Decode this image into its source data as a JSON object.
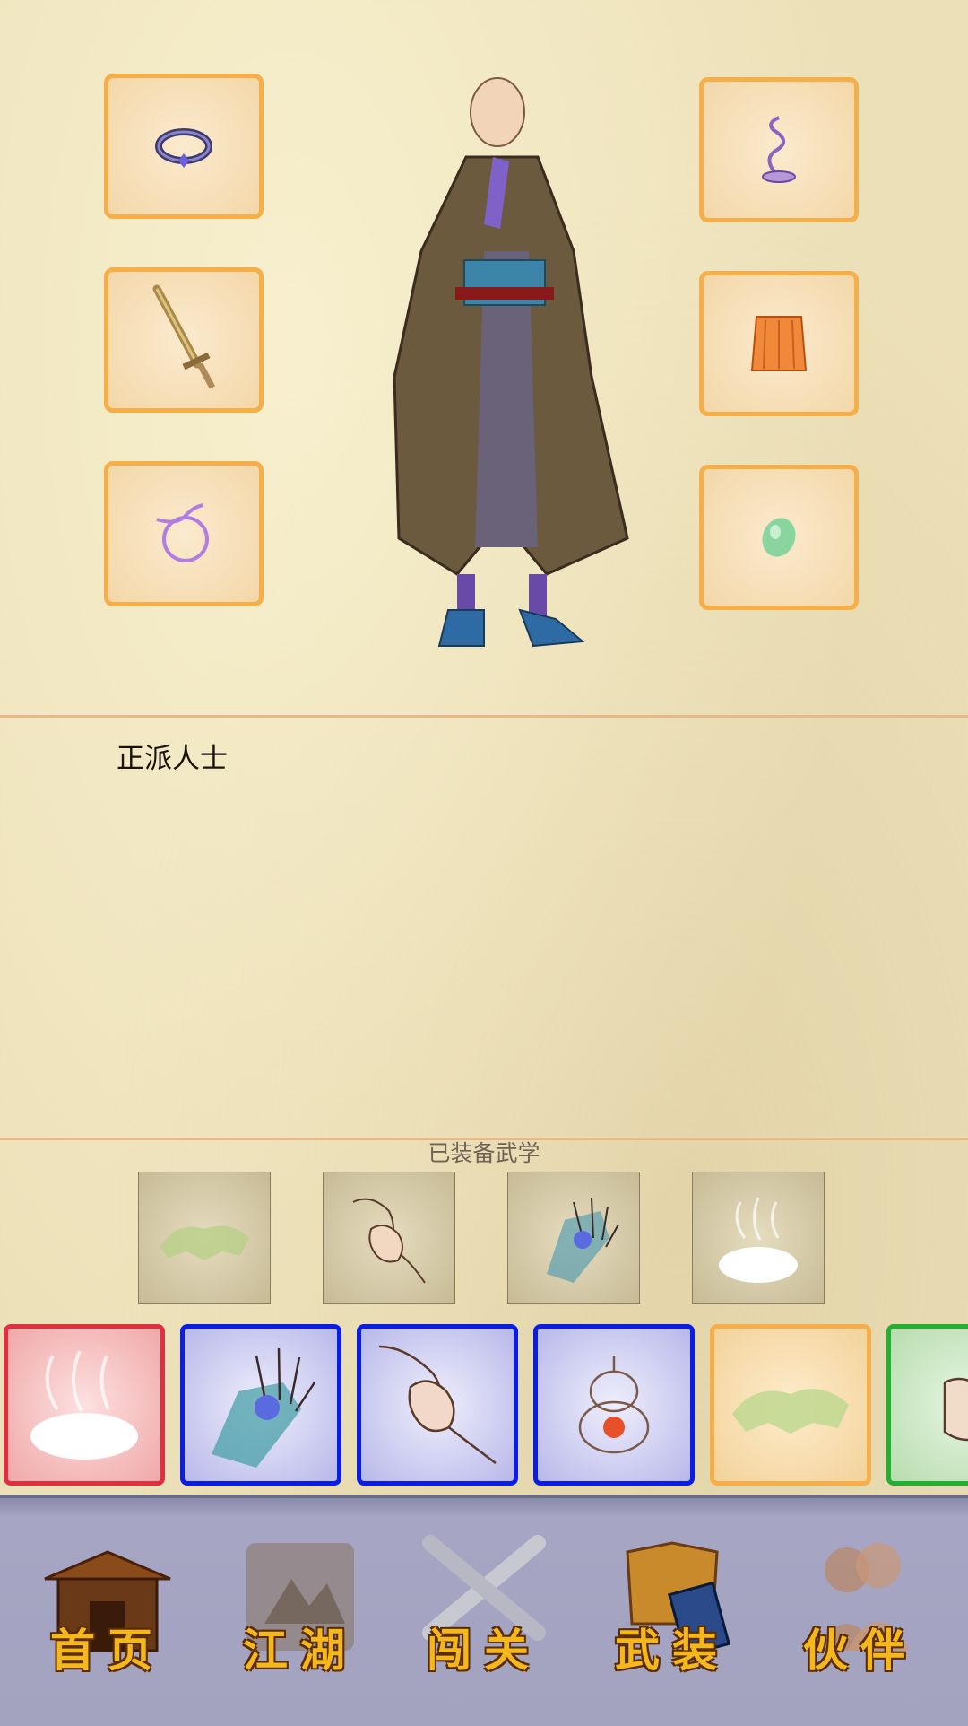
{
  "character": {
    "title": "正派人士",
    "hero_image": "monk-hero",
    "equipment_left": [
      {
        "name": "ring",
        "icon": "purple-ring-icon"
      },
      {
        "name": "sword",
        "icon": "sword-icon"
      },
      {
        "name": "bracelet",
        "icon": "ribbon-ring-icon"
      }
    ],
    "equipment_right": [
      {
        "name": "incense",
        "icon": "incense-icon"
      },
      {
        "name": "robe",
        "icon": "orange-cloth-icon"
      },
      {
        "name": "jade",
        "icon": "jade-icon"
      }
    ]
  },
  "martial": {
    "header": "已装备武学",
    "equipped": [
      "green-beast-icon",
      "clasped-fists-icon",
      "palm-strike-icon",
      "mist-cloud-icon"
    ]
  },
  "skills_strip": [
    {
      "icon": "mist-cloud-icon",
      "color": "red"
    },
    {
      "icon": "palm-strike-icon",
      "color": "blue"
    },
    {
      "icon": "clasped-fists-icon",
      "color": "blue"
    },
    {
      "icon": "gourd-icon",
      "color": "blue"
    },
    {
      "icon": "green-beast-icon",
      "color": "orange"
    },
    {
      "icon": "fist-icon",
      "color": "green"
    }
  ],
  "nav": {
    "home": "首页",
    "jianghu": "江湖",
    "challenge": "闯关",
    "equipment": "武装",
    "partners": "伙伴"
  }
}
